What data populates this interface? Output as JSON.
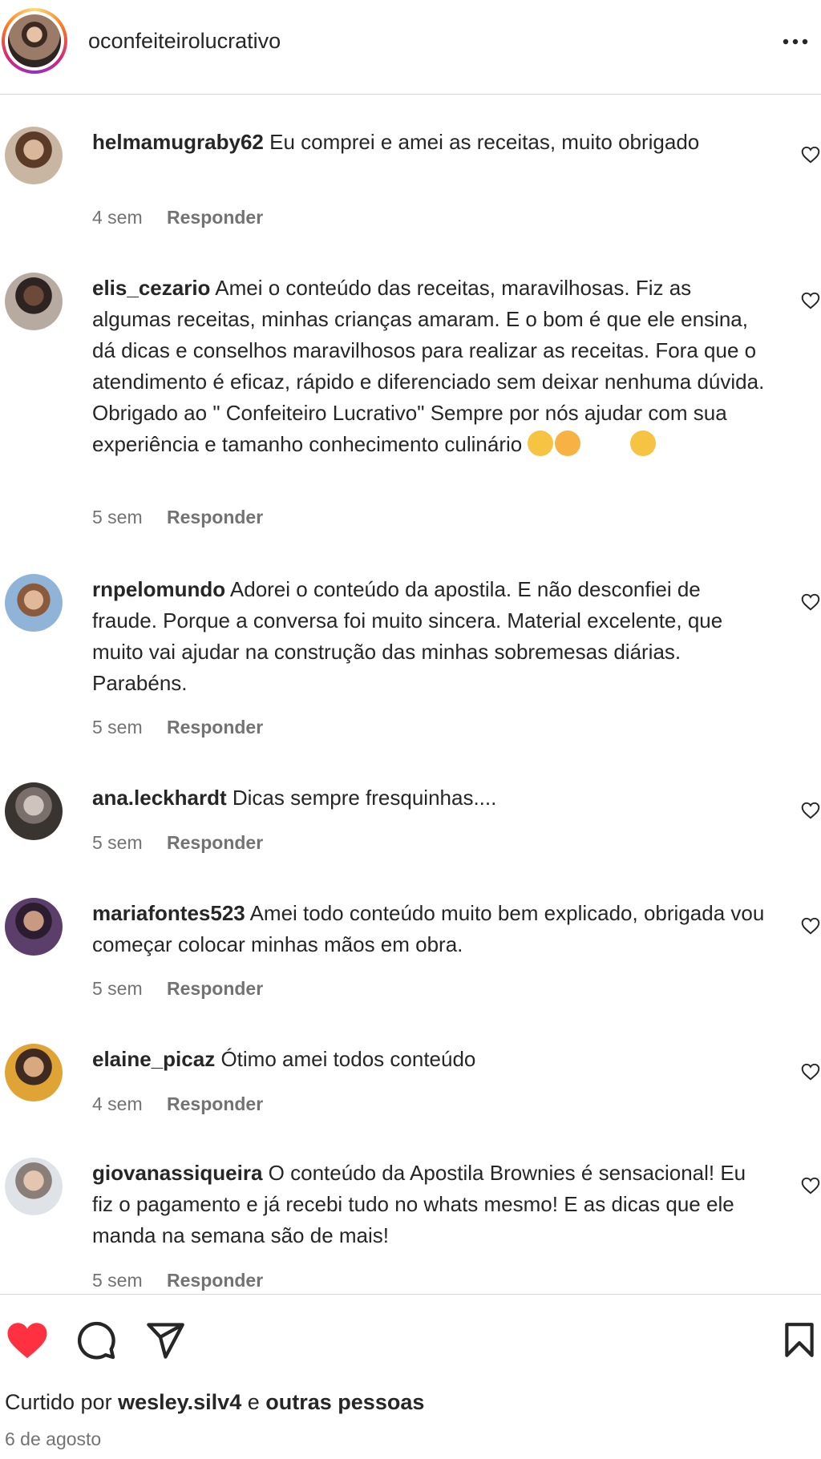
{
  "header": {
    "username": "oconfeiteirolucrativo",
    "more_icon": "more-horizontal-icon"
  },
  "comments": [
    {
      "user": "helmamugraby62",
      "text": "Eu comprei e amei as receitas, muito obrigado",
      "time": "4 sem",
      "reply": "Responder"
    },
    {
      "user": "elis_cezario",
      "text": "Amei o conteúdo das receitas, maravilhosas. Fiz as algumas receitas, minhas crianças amaram. E o bom é que ele ensina, dá dicas e conselhos maravilhosos para realizar as receitas. Fora que o atendimento é eficaz, rápido e diferenciado sem deixar nenhuma dúvida. Obrigado ao \" Confeiteiro Lucrativo\" Sempre por nós ajudar com sua experiência e tamanho conhecimento culinário",
      "time": "5 sem",
      "reply": "Responder"
    },
    {
      "user": "rnpelomundo",
      "text": "Adorei o conteúdo da apostila. E não desconfiei de fraude. Porque a conversa foi muito sincera. Material excelente, que muito vai ajudar na construção das minhas sobremesas diárias. Parabéns.",
      "time": "5 sem",
      "reply": "Responder"
    },
    {
      "user": "ana.leckhardt",
      "text": "Dicas sempre fresquinhas....",
      "time": "5 sem",
      "reply": "Responder"
    },
    {
      "user": "mariafontes523",
      "text": "Amei todo conteúdo muito bem explicado, obrigada vou começar colocar minhas mãos em obra.",
      "time": "5 sem",
      "reply": "Responder"
    },
    {
      "user": "elaine_picaz",
      "text": "Ótimo amei todos conteúdo",
      "time": "4 sem",
      "reply": "Responder"
    },
    {
      "user": "giovanassiqueira",
      "text": "O conteúdo da Apostila Brownies é sensacional! Eu fiz o pagamento e já recebi tudo no whats mesmo! E as dicas que ele manda na semana são de mais!",
      "time": "5 sem",
      "reply": "Responder"
    }
  ],
  "actions": {
    "like_icon": "heart-filled-icon",
    "comment_icon": "comment-icon",
    "share_icon": "send-icon",
    "save_icon": "bookmark-icon",
    "like_color": "#ff3040"
  },
  "likes": {
    "prefix": "Curtido por",
    "user": "wesley.silv4",
    "connector": "e",
    "others": "outras pessoas"
  },
  "date": "6 de agosto"
}
